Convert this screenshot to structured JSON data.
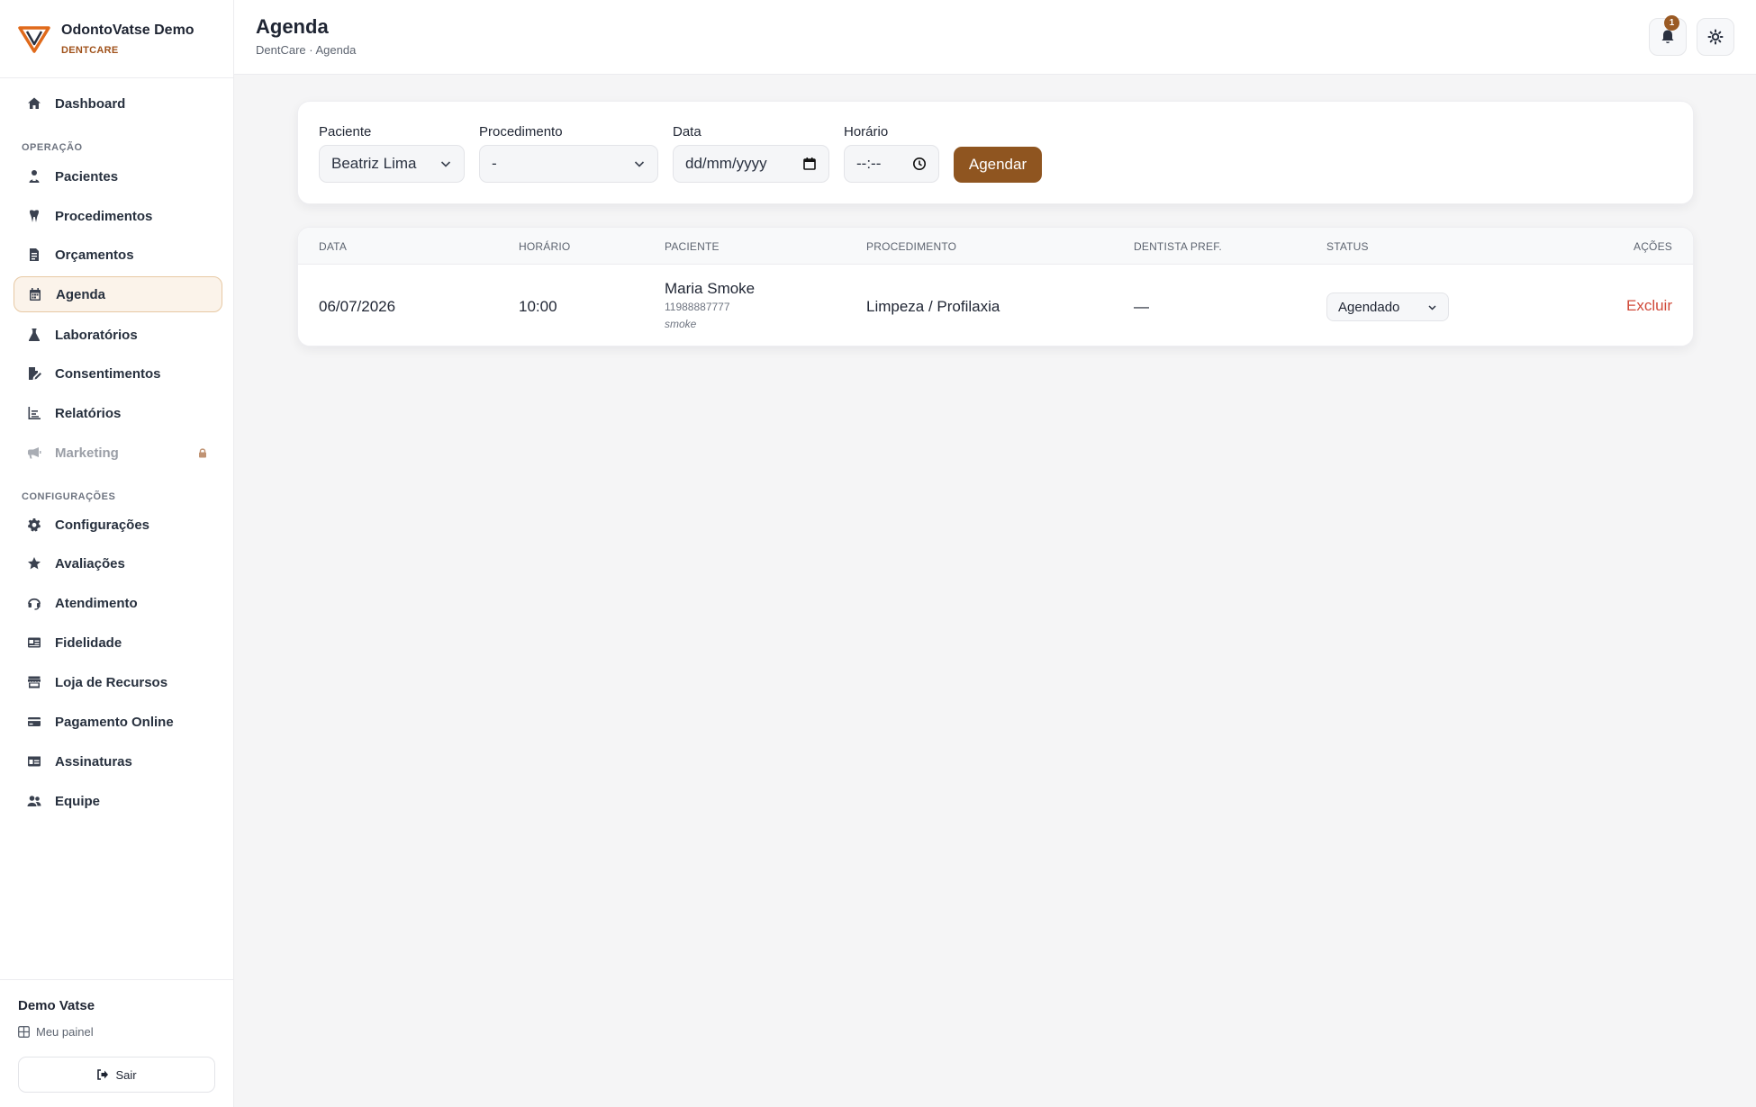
{
  "brand": {
    "name": "OdontoVatse Demo",
    "subtitle": "DENTCARE",
    "color": "#a0521b"
  },
  "sidebar": {
    "dashboard": {
      "label": "Dashboard",
      "icon": "home-icon"
    },
    "sections": [
      {
        "label": "OPERAÇÃO",
        "items": [
          {
            "label": "Pacientes",
            "icon": "patient-icon"
          },
          {
            "label": "Procedimentos",
            "icon": "tooth-icon"
          },
          {
            "label": "Orçamentos",
            "icon": "document-icon"
          },
          {
            "label": "Agenda",
            "icon": "calendar-icon",
            "active": true
          },
          {
            "label": "Laboratórios",
            "icon": "flask-icon"
          },
          {
            "label": "Consentimentos",
            "icon": "signature-icon"
          },
          {
            "label": "Relatórios",
            "icon": "chart-icon"
          },
          {
            "label": "Marketing",
            "icon": "megaphone-icon",
            "locked": true
          }
        ]
      },
      {
        "label": "CONFIGURAÇÕES",
        "items": [
          {
            "label": "Configurações",
            "icon": "gear-icon"
          },
          {
            "label": "Avaliações",
            "icon": "star-icon"
          },
          {
            "label": "Atendimento",
            "icon": "headset-icon"
          },
          {
            "label": "Fidelidade",
            "icon": "card-icon"
          },
          {
            "label": "Loja de Recursos",
            "icon": "store-icon"
          },
          {
            "label": "Pagamento Online",
            "icon": "credit-card-icon"
          },
          {
            "label": "Assinaturas",
            "icon": "id-card-icon"
          },
          {
            "label": "Equipe",
            "icon": "team-icon"
          }
        ]
      }
    ],
    "footer": {
      "user": "Demo Vatse",
      "panel_link": "Meu painel",
      "logout": "Sair"
    }
  },
  "header": {
    "title": "Agenda",
    "breadcrumb": "DentCare · Agenda",
    "notifications_count": "1"
  },
  "form": {
    "patient": {
      "label": "Paciente",
      "value": "Beatriz Lima"
    },
    "procedure": {
      "label": "Procedimento",
      "value": "-"
    },
    "date": {
      "label": "Data",
      "value": "dd/mm/yyyy"
    },
    "time": {
      "label": "Horário",
      "value": "--:--"
    },
    "submit": "Agendar",
    "accent": "#8f5520"
  },
  "table": {
    "columns": [
      "DATA",
      "HORÁRIO",
      "PACIENTE",
      "PROCEDIMENTO",
      "DENTISTA PREF.",
      "STATUS",
      "AÇÕES"
    ],
    "rows": [
      {
        "date": "06/07/2026",
        "time": "10:00",
        "patient": "Maria Smoke",
        "phone": "11988887777",
        "tag": "smoke",
        "procedure": "Limpeza / Profilaxia",
        "dentist": "—",
        "status": "Agendado",
        "action": "Excluir"
      }
    ]
  }
}
